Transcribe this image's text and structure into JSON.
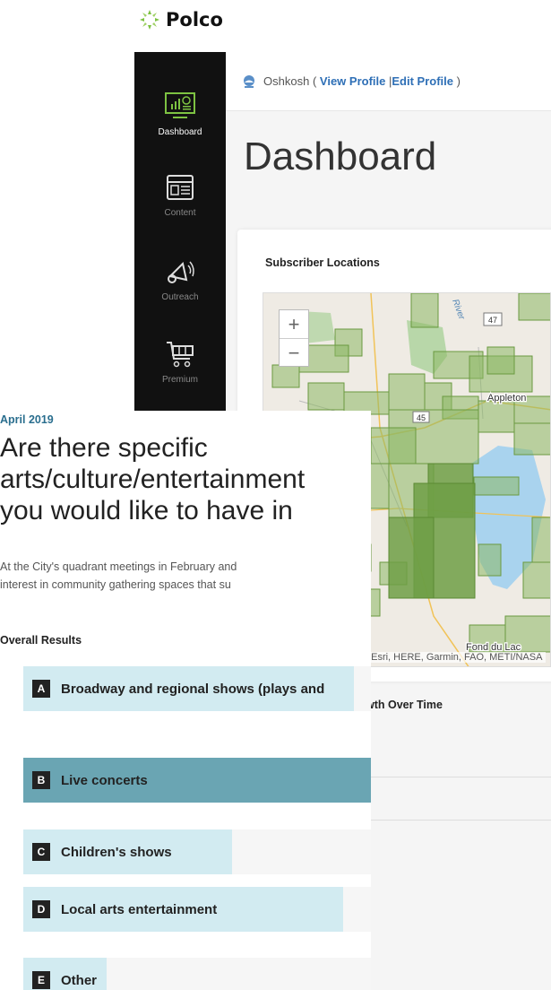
{
  "logo": {
    "text": "Polco"
  },
  "sidebar": {
    "items": [
      {
        "label": "Dashboard",
        "icon": "dashboard-monitor-icon",
        "active": true
      },
      {
        "label": "Content",
        "icon": "content-window-icon",
        "active": false
      },
      {
        "label": "Outreach",
        "icon": "megaphone-icon",
        "active": false
      },
      {
        "label": "Premium",
        "icon": "cart-icon",
        "active": false
      }
    ]
  },
  "topbar": {
    "org_name": "Oshkosh",
    "open_paren": "(",
    "view_profile": "View Profile",
    "separator": "|",
    "edit_profile": "Edit Profile",
    "close_paren": ")"
  },
  "dashboard": {
    "title": "Dashboard",
    "subscriber_card_title": "Subscriber Locations",
    "growth_card_title_visible": "wth Over Time"
  },
  "map": {
    "zoom_in": "+",
    "zoom_out": "−",
    "labels": {
      "highway_47": "47",
      "highway_45": "45",
      "river": "River",
      "appleton": "Appleton",
      "fond_du_lac": "Fond du Lac"
    },
    "attribution": ", Esri, HERE, Garmin, FAO, METI/NASA"
  },
  "survey": {
    "date": "April 2019",
    "question_lines": [
      "Are there specific",
      "arts/culture/entertainment",
      "you would like to have in"
    ],
    "description_lines": [
      "At the City's quadrant meetings in February and",
      "interest in community gathering spaces that su"
    ],
    "results_heading": "Overall Results",
    "options": [
      {
        "letter": "A",
        "label": "Broadway and regional shows (plays and",
        "share": 0.95,
        "selected": false
      },
      {
        "letter": "B",
        "label": "Live concerts",
        "share": 1.0,
        "selected": true
      },
      {
        "letter": "C",
        "label": "Children's shows",
        "share": 0.6,
        "selected": false
      },
      {
        "letter": "D",
        "label": "Local arts entertainment",
        "share": 0.92,
        "selected": false
      },
      {
        "letter": "E",
        "label": "Other",
        "share": 0.24,
        "selected": false
      }
    ]
  },
  "colors": {
    "sidebar_bg": "#111111",
    "accent_green": "#7dc242",
    "link_blue": "#2e6fb6",
    "bar_fill": "#d2ebf1",
    "bar_selected": "#6aa5b3",
    "date_color": "#2a6e8e",
    "map_polygon": "#8db865"
  }
}
